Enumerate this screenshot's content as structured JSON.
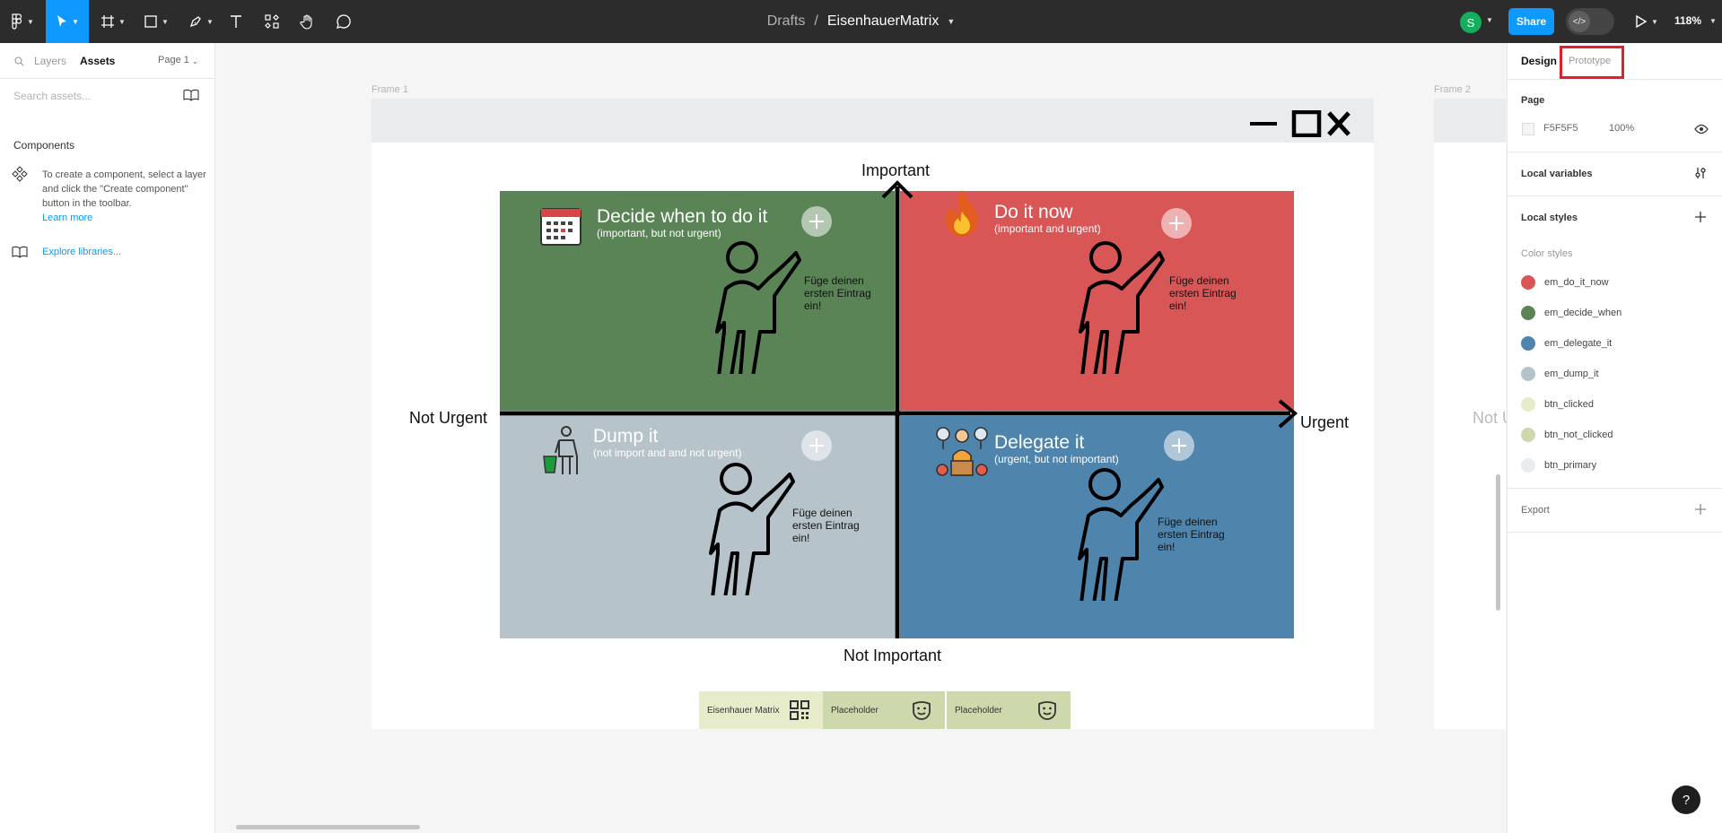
{
  "toolbar": {
    "breadcrumb": "Drafts",
    "separator": "/",
    "file_name": "EisenhauerMatrix",
    "avatar_initial": "S",
    "share_label": "Share",
    "zoom": "118%"
  },
  "left_panel": {
    "tabs": [
      "Layers",
      "Assets"
    ],
    "page_selector": "Page 1",
    "search_placeholder": "Search assets...",
    "components_heading": "Components",
    "components_help": "To create a component, select a layer and click the \"Create component\" button in the toolbar.",
    "learn_more": "Learn more",
    "explore_libraries": "Explore libraries..."
  },
  "canvas": {
    "frame1_label": "Frame 1",
    "frame2_label": "Frame 2",
    "frame2_partial_text": "Not U",
    "axis": {
      "top": "Important",
      "bottom": "Not Important",
      "left": "Not Urgent",
      "right": "Urgent"
    },
    "quadrants": [
      {
        "title": "Decide when to do it",
        "subtitle": "(important, but not urgent)",
        "entry": "Füge deinen ersten Eintrag ein!",
        "color": "#5a8456"
      },
      {
        "title": "Do it now",
        "subtitle": "(important and urgent)",
        "entry": "Füge deinen ersten Eintrag ein!",
        "color": "#d95656"
      },
      {
        "title": "Dump it",
        "subtitle": "(not import and and not urgent)",
        "entry": "Füge deinen ersten Eintrag ein!",
        "color": "#b7c3ca"
      },
      {
        "title": "Delegate it",
        "subtitle": "(urgent, but not important)",
        "entry": "Füge deinen ersten Eintrag ein!",
        "color": "#4f84ac"
      }
    ],
    "footer_tabs": [
      {
        "label": "Eisenhauer Matrix",
        "icon": "qr-code-icon",
        "color": "#e6ebc9"
      },
      {
        "label": "Placeholder",
        "icon": "smiley-icon",
        "color": "#ced8ad"
      },
      {
        "label": "Placeholder",
        "icon": "smiley-icon",
        "color": "#ced8ad"
      }
    ]
  },
  "right_panel": {
    "tabs": [
      "Design",
      "Prototype"
    ],
    "page_heading": "Page",
    "page_color": "F5F5F5",
    "page_opacity": "100%",
    "local_variables": "Local variables",
    "local_styles": "Local styles",
    "color_styles_heading": "Color styles",
    "color_styles": [
      {
        "name": "em_do_it_now",
        "color": "#d95656"
      },
      {
        "name": "em_decide_when",
        "color": "#5a8456"
      },
      {
        "name": "em_delegate_it",
        "color": "#4f84ac"
      },
      {
        "name": "em_dump_it",
        "color": "#b7c3ca"
      },
      {
        "name": "btn_clicked",
        "color": "#e6ebc9"
      },
      {
        "name": "btn_not_clicked",
        "color": "#ced8ad"
      },
      {
        "name": "btn_primary",
        "color": "#e9ebed"
      }
    ],
    "export": "Export",
    "help": "?"
  }
}
